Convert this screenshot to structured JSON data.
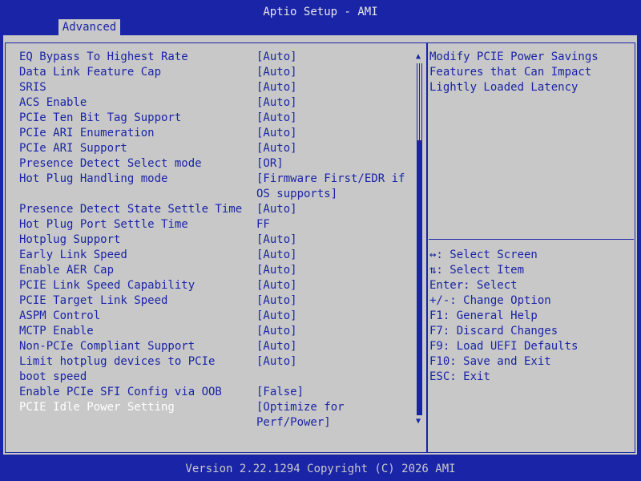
{
  "header": {
    "title": "Aptio Setup - AMI"
  },
  "tabs": [
    {
      "label": "Advanced"
    }
  ],
  "settings": [
    {
      "label": "EQ Bypass To Highest Rate",
      "value": "[Auto]"
    },
    {
      "label": "Data Link Feature Cap",
      "value": "[Auto]"
    },
    {
      "label": "SRIS",
      "value": "[Auto]"
    },
    {
      "label": "ACS Enable",
      "value": "[Auto]"
    },
    {
      "label": "PCIe Ten Bit Tag Support",
      "value": "[Auto]"
    },
    {
      "label": "PCIe ARI Enumeration",
      "value": "[Auto]"
    },
    {
      "label": "PCIe ARI Support",
      "value": "[Auto]"
    },
    {
      "label": "Presence Detect Select mode",
      "value": "[OR]"
    },
    {
      "label": "Hot Plug Handling mode",
      "value": "[Firmware First/EDR if",
      "value2": "OS supports]"
    },
    {
      "label": "Presence Detect State Settle Time",
      "value": "[Auto]"
    },
    {
      "label": "Hot Plug Port Settle Time",
      "value": "FF"
    },
    {
      "label": "Hotplug Support",
      "value": "[Auto]"
    },
    {
      "label": "Early Link Speed",
      "value": "[Auto]"
    },
    {
      "label": "Enable AER Cap",
      "value": "[Auto]"
    },
    {
      "label": "PCIE Link Speed Capability",
      "value": "[Auto]"
    },
    {
      "label": "PCIE Target Link Speed",
      "value": "[Auto]"
    },
    {
      "label": "ASPM Control",
      "value": "[Auto]"
    },
    {
      "label": "MCTP Enable",
      "value": "[Auto]"
    },
    {
      "label": "Non-PCIe Compliant Support",
      "value": "[Auto]"
    },
    {
      "label": "Limit hotplug devices to PCIe",
      "label2": "boot speed",
      "value": "[Auto]"
    },
    {
      "label": "Enable PCIe SFI Config via OOB",
      "value": "[False]"
    },
    {
      "label": "PCIE Idle Power Setting",
      "value": "[Optimize for",
      "value2": "Perf/Power]",
      "selected": true
    }
  ],
  "help": {
    "description": [
      "Modify PCIE Power Savings",
      "Features that Can Impact",
      "Lightly Loaded Latency"
    ],
    "keys": [
      "↔: Select Screen",
      "⇅: Select Item",
      "Enter: Select",
      "+/-: Change Option",
      "F1: General Help",
      "F7: Discard Changes",
      "F9: Load UEFI Defaults",
      "F10: Save and Exit",
      "ESC: Exit"
    ]
  },
  "scrollbar": {
    "up_icon": "triangle-up",
    "down_icon": "triangle-down"
  },
  "footer": {
    "text": "Version 2.22.1294 Copyright (C) 2026 AMI"
  },
  "colors": {
    "background": "#1a24a6",
    "panel": "#c8c8c8",
    "selected_text": "#ffffff"
  }
}
